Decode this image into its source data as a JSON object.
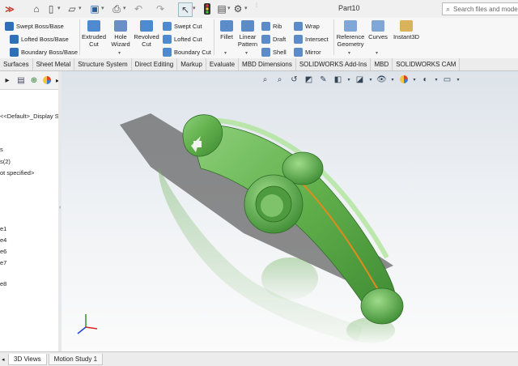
{
  "window": {
    "title": "Part10"
  },
  "quick_access": {
    "icons": [
      "home-icon",
      "new-document-icon",
      "open-icon",
      "save-icon",
      "print-icon",
      "undo-icon",
      "redo-icon",
      "select-cursor-icon",
      "traffic-light-icon",
      "file-properties-icon",
      "options-gear-icon"
    ]
  },
  "search": {
    "placeholder": "Search files and models"
  },
  "ribbon": {
    "boss_base": {
      "swept": "Swept Boss/Base",
      "lofted": "Lofted Boss/Base",
      "boundary": "Boundary Boss/Base"
    },
    "extruded_cut": "Extruded\nCut",
    "extruded_cut_l1": "Extruded",
    "extruded_cut_l2": "Cut",
    "hole_wizard_l1": "Hole",
    "hole_wizard_l2": "Wizard",
    "revolved_cut_l1": "Revolved",
    "revolved_cut_l2": "Cut",
    "swept_cut": "Swept Cut",
    "lofted_cut": "Lofted Cut",
    "boundary_cut": "Boundary Cut",
    "fillet": "Fillet",
    "linear_pattern_l1": "Linear",
    "linear_pattern_l2": "Pattern",
    "rib": "Rib",
    "draft": "Draft",
    "shell": "Shell",
    "wrap": "Wrap",
    "intersect": "Intersect",
    "mirror": "Mirror",
    "ref_geometry_l1": "Reference",
    "ref_geometry_l2": "Geometry",
    "curves": "Curves",
    "instant3d": "Instant3D"
  },
  "tabs": [
    "Surfaces",
    "Sheet Metal",
    "Structure System",
    "Direct Editing",
    "Markup",
    "Evaluate",
    "MBD Dimensions",
    "SOLIDWORKS Add-Ins",
    "MBD",
    "SOLIDWORKS CAM"
  ],
  "tree": {
    "items": [
      "<<Default>_Display S",
      "s",
      "s(2)",
      "ot specified>",
      "e1",
      "e4",
      "e6",
      "e7",
      "e8"
    ]
  },
  "bottom_tabs": [
    "3D Views",
    "Motion Study 1"
  ],
  "colors": {
    "part_green": "#5fae4a",
    "edge_orange": "#e08a1e",
    "ribbon_bg": "#f7f7f7"
  }
}
